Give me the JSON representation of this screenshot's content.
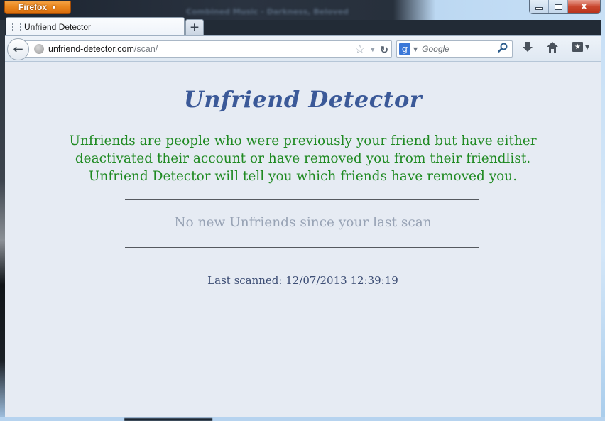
{
  "browser": {
    "app_menu_label": "Firefox",
    "background_window_title": "Combined Music - Darkness, Beloved",
    "tabs": [
      {
        "label": "Unfriend Detector",
        "active": true
      }
    ],
    "new_tab_label": "+",
    "url": {
      "host": "unfriend-detector.com",
      "path": "/scan/"
    },
    "search": {
      "engine_icon": "g",
      "placeholder": "Google"
    },
    "icons": {
      "back": "←",
      "star": "☆",
      "dropmarker": "▼",
      "reload": "↻",
      "magnifier": "⚲",
      "download": "⬇",
      "home": "⌂",
      "bookmarks": "★",
      "caret": "▼",
      "close": "X"
    }
  },
  "page": {
    "title": "Unfriend Detector",
    "intro": "Unfriends are people who were previously your friend but have either deactivated their account or have removed you from their friendlist. Unfriend Detector will tell you which friends have removed you.",
    "status_message": "No new Unfriends since your last scan",
    "last_scanned": "Last scanned: 12/07/2013 12:39:19"
  },
  "colors": {
    "title": "#3b5998",
    "intro": "#1f8a22",
    "status": "#98a3b5",
    "last_scanned": "#3c4d74",
    "background": "#e6ebf3"
  }
}
